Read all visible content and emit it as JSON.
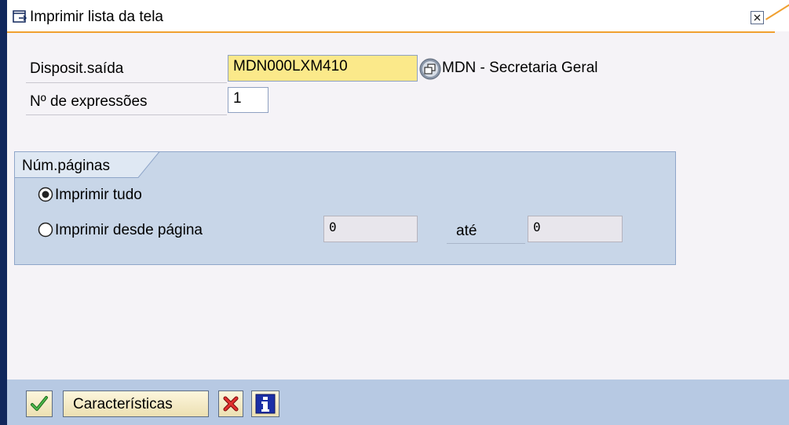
{
  "window": {
    "title": "Imprimir lista da tela"
  },
  "form": {
    "output_device_label": "Disposit.saída",
    "output_device_value": "MDN000LXM410",
    "output_device_description": "MDN - Secretaria Geral",
    "copies_label": "Nº de expressões",
    "copies_value": "1"
  },
  "pages_group": {
    "title": "Núm.páginas",
    "print_all_label": "Imprimir tudo",
    "print_all_selected": true,
    "print_from_label": "Imprimir desde página",
    "print_from_selected": false,
    "from_page_value": "0",
    "until_label": "até",
    "until_page_value": "0"
  },
  "footer": {
    "properties_label": "Características"
  },
  "icons": {
    "title": "print-dialog-icon",
    "close": "close-icon",
    "dropdown": "possible-entries-icon",
    "confirm": "checkmark-icon",
    "cancel": "cancel-x-icon",
    "info": "info-icon"
  },
  "colors": {
    "required_field": "#fbe98a",
    "group_background": "#c8d6e8",
    "footer_background": "#b7c9e3",
    "title_accent": "#f0a030",
    "left_edge": "#10275c"
  }
}
